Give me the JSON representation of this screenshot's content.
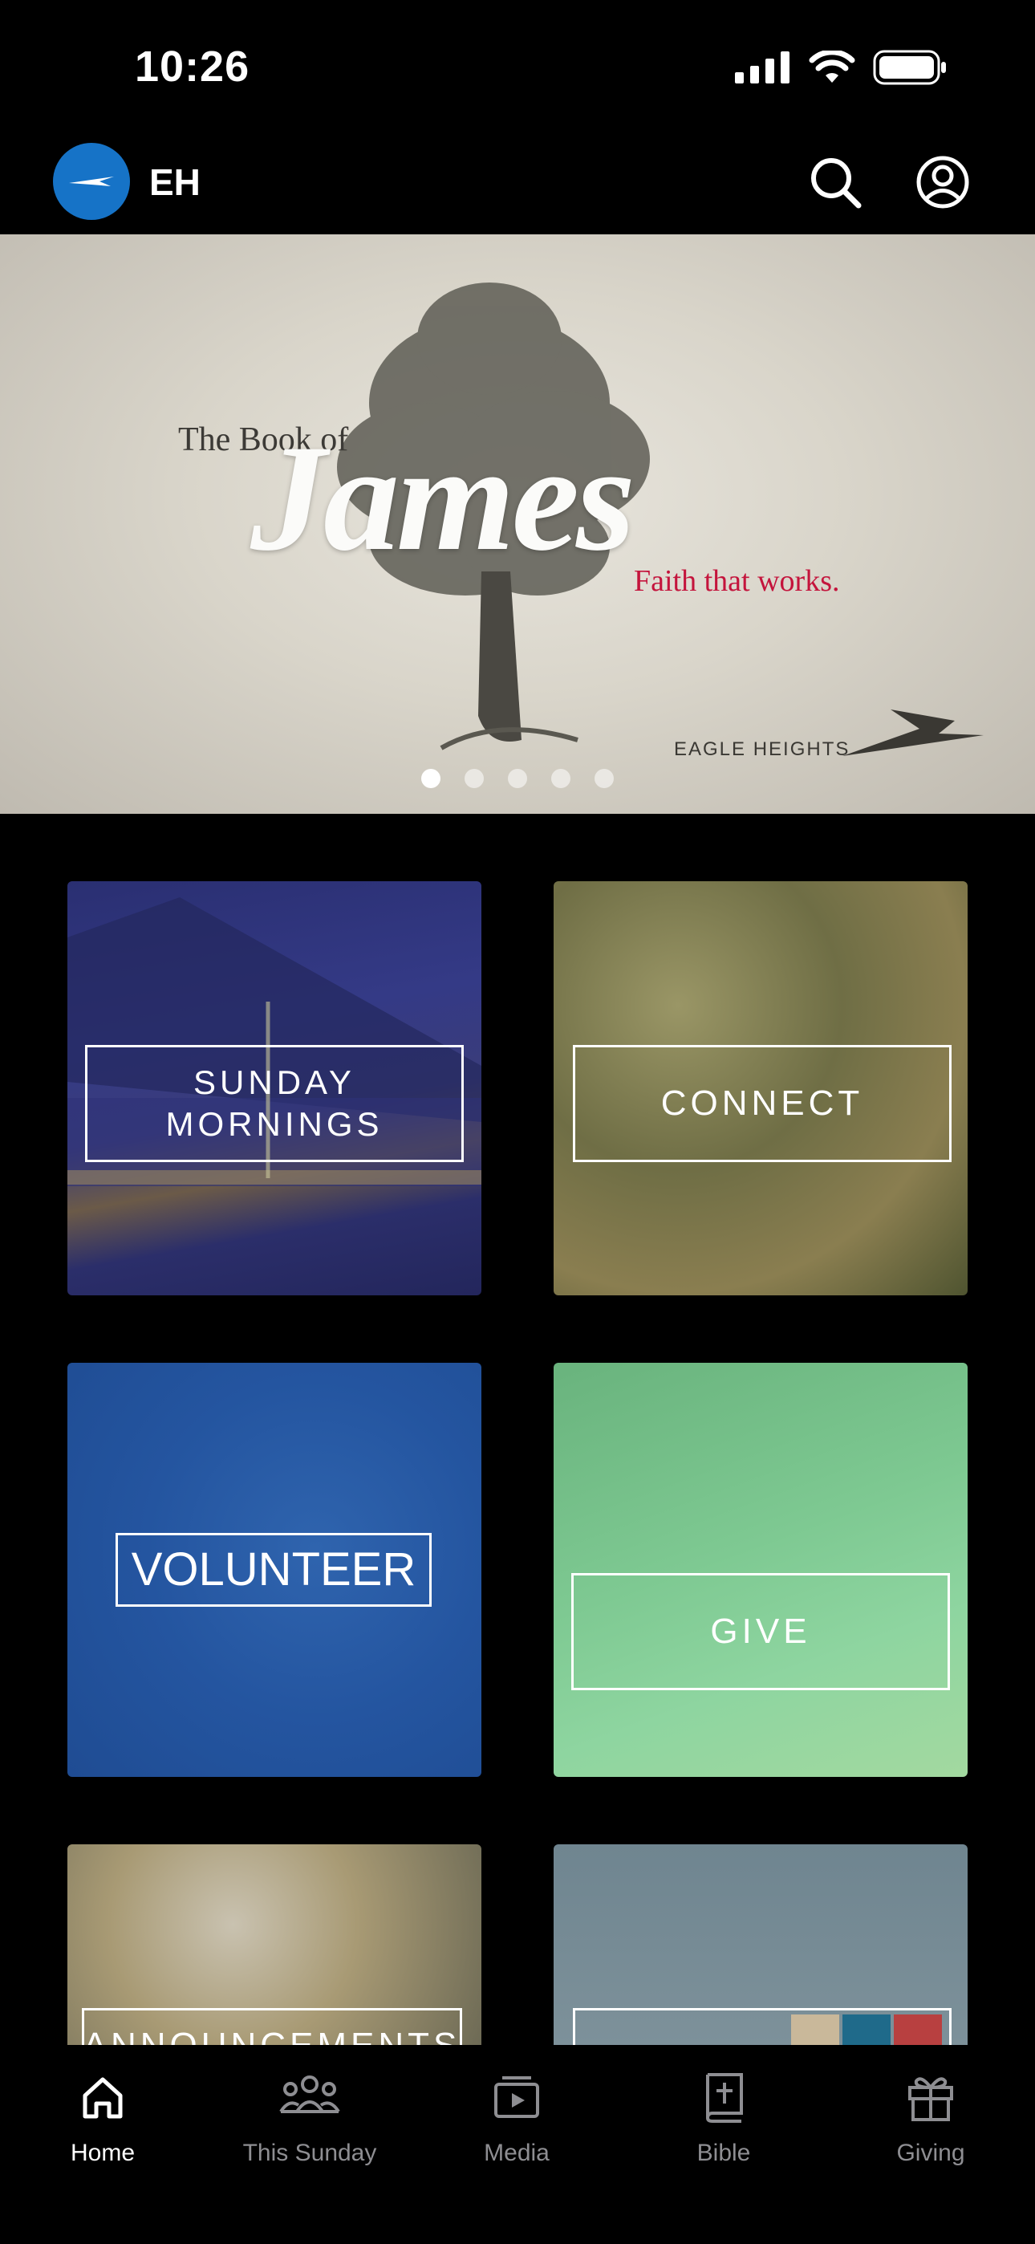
{
  "status_bar": {
    "time": "10:26"
  },
  "header": {
    "brand": "EH",
    "logo_icon": "eagle-logo-icon"
  },
  "hero": {
    "pre_title": "The Book of",
    "title": "James",
    "subtitle": "Faith that works.",
    "org": "EAGLE HEIGHTS",
    "colors": {
      "subtitle": "#c4143c"
    },
    "slide_count": 5,
    "active_slide": 1
  },
  "tiles": [
    {
      "label": "SUNDAY MORNINGS"
    },
    {
      "label": "CONNECT"
    },
    {
      "label": "VOLUNTEER"
    },
    {
      "label": "GIVE"
    },
    {
      "label": "ANNOUNCEMENTS"
    },
    {
      "label": ""
    }
  ],
  "tabbar": {
    "items": [
      {
        "label": "Home",
        "icon": "home-icon",
        "active": true
      },
      {
        "label": "This Sunday",
        "icon": "people-icon"
      },
      {
        "label": "Media",
        "icon": "media-icon"
      },
      {
        "label": "Bible",
        "icon": "bible-icon"
      },
      {
        "label": "Giving",
        "icon": "gift-icon"
      }
    ]
  }
}
